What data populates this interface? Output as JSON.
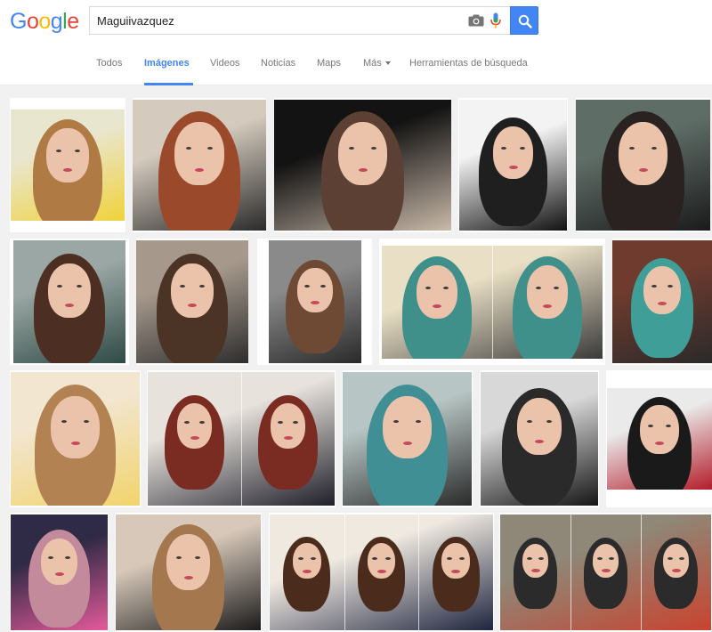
{
  "search": {
    "query": "Maguiivazquez"
  },
  "logo": {
    "letters": [
      "G",
      "o",
      "o",
      "g",
      "l",
      "e"
    ],
    "colors": [
      "#4285f4",
      "#ea4335",
      "#fbbc05",
      "#4285f4",
      "#34a853",
      "#ea4335"
    ]
  },
  "nav": {
    "todos": "Todos",
    "imagenes": "Imágenes",
    "videos": "Videos",
    "noticias": "Noticias",
    "maps": "Maps",
    "mas": "Más",
    "herramientas": "Herramientas de búsqueda"
  },
  "theme": {
    "accent": "#4285f4",
    "background": "#f1f1f1"
  },
  "results": {
    "count": 20,
    "photo_palettes": [
      [
        "#e9e6cf",
        "#b07a45",
        "#f0d23a"
      ],
      [
        "#d4cabd",
        "#9a4a2a",
        "#2a2a2a"
      ],
      [
        "#131313",
        "#5c4033",
        "#c9b9a9"
      ],
      [
        "#f3f3f3",
        "#1f1f1f",
        "#111111"
      ],
      [
        "#5f6d67",
        "#2a2220",
        "#1a1a1a"
      ],
      [
        "#9aa7a4",
        "#4c2f22",
        "#2f4a45"
      ],
      [
        "#a6998c",
        "#4b3326",
        "#2e2e2e"
      ],
      [
        "#8a8a8a",
        "#6e4a35",
        "#2a2a2a"
      ],
      [
        "#e9dfc4",
        "#3f8f8a",
        "#3a3a3a"
      ],
      [
        "#6e3b2e",
        "#3f9f98",
        "#2a2a2a"
      ],
      [
        "#f2e6d0",
        "#b38252",
        "#f2d36b"
      ],
      [
        "#e7e2dc",
        "#7b2c22",
        "#1f1f2a"
      ],
      [
        "#b7c6c4",
        "#3f8f94",
        "#2a2a2a"
      ],
      [
        "#d8d8d8",
        "#2a2a2a",
        "#151515"
      ],
      [
        "#eaeaea",
        "#1a1a1a",
        "#b31d2a"
      ],
      [
        "#2f2a45",
        "#c28a9a",
        "#e45a9a"
      ],
      [
        "#d7c8b9",
        "#a5774f",
        "#1b1b1b"
      ],
      [
        "#efe9e0",
        "#4b2c1c",
        "#1f2540"
      ],
      [
        "#8f8777",
        "#2b2b2b",
        "#c9432f"
      ],
      [
        "#ffffff",
        "#ffffff",
        "#ffffff"
      ]
    ],
    "image_labels": [
      "",
      "",
      "",
      "",
      "",
      "",
      "",
      "",
      "",
      "",
      "",
      "",
      "",
      "",
      "",
      "",
      "",
      "",
      "",
      ""
    ]
  }
}
